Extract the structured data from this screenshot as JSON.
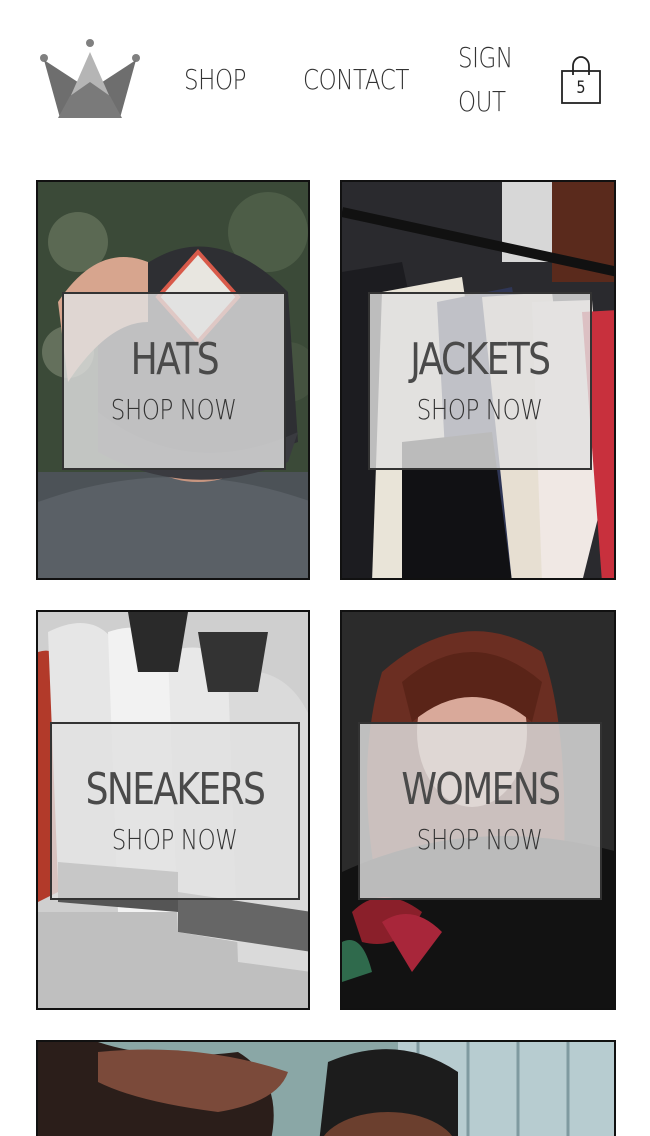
{
  "header": {
    "logo_icon": "crown-logo-icon",
    "nav": {
      "shop": "SHOP",
      "contact": "CONTACT",
      "sign_out": "SIGN OUT"
    },
    "cart": {
      "icon": "shopping-bag-icon",
      "count": "5"
    }
  },
  "directory": {
    "items": [
      {
        "title": "HATS",
        "subtitle": "SHOP NOW"
      },
      {
        "title": "JACKETS",
        "subtitle": "SHOP NOW"
      },
      {
        "title": "SNEAKERS",
        "subtitle": "SHOP NOW"
      },
      {
        "title": "WOMENS",
        "subtitle": "SHOP NOW"
      }
    ]
  },
  "colors": {
    "text": "#333333",
    "border": "#111111",
    "label_box_bg": "#e1e1e1"
  }
}
